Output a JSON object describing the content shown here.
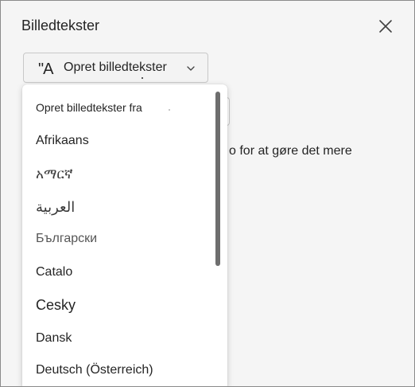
{
  "panel": {
    "title": "Billedtekster",
    "close_icon": "close-icon"
  },
  "caption_button": {
    "icon": "\"A",
    "label": "Opret billedtekster",
    "chevron_icon": "chevron-down-icon"
  },
  "background": {
    "text": "o for at gøre det mere"
  },
  "dropdown": {
    "header": "Opret billedtekster fra",
    "options": [
      {
        "label": "Afrikaans"
      },
      {
        "label": "አማርኛ"
      },
      {
        "label": "العربية"
      },
      {
        "label": "Български"
      },
      {
        "label": "Catalo"
      },
      {
        "label": "Cesky"
      },
      {
        "label": "Dansk"
      },
      {
        "label": "Deutsch (Österreich)"
      }
    ]
  }
}
